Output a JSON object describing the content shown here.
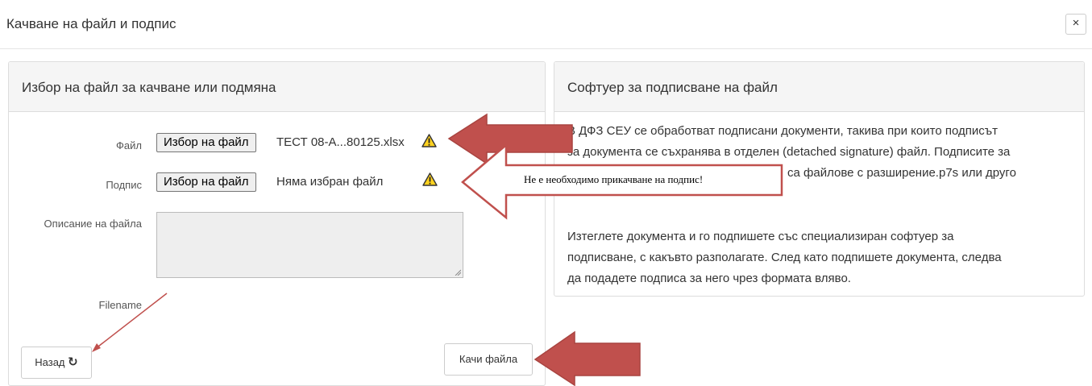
{
  "modal": {
    "title": "Качване на файл и подпис",
    "close_label": "×"
  },
  "left_panel": {
    "title": "Избор на файл за качване или подмяна",
    "file_label": "Файл",
    "file_button": "Избор на файл",
    "file_name": "ТЕСТ 08-А...80125.xlsx",
    "signature_label": "Подпис",
    "signature_button": "Избор на файл",
    "signature_name": "Няма избран файл",
    "description_label": "Описание на файла",
    "filename_label": "Filename",
    "back_button": "Назад",
    "back_icon": "↻",
    "upload_button": "Качи файла"
  },
  "right_panel": {
    "title": "Софтуер за подписване на файл",
    "para1_line1": "В ДФЗ СЕУ се обработват подписани документи, такива при които подписът",
    "para1_line2": "за документа се съхранява в отделен (detached signature) файл. Подписите за",
    "para1_line3": "са файлове с разширение.p7s или друго",
    "para2_line1": "Изтеглете документа и го подпишете със специализиран софтуер за",
    "para2_line2": "подписване, с какъвто разполагате. След като подпишете документа, следва",
    "para2_line3": "да подадете подписа за него чрез формата вляво."
  },
  "annotation": {
    "callout_text": "Не е необходимо прикачване на подпис!"
  },
  "icons": {
    "warning": "warning-icon",
    "close": "close-icon",
    "refresh": "refresh-icon"
  },
  "colors": {
    "arrow_fill": "#c0504d",
    "arrow_stroke": "#b55a55",
    "warning_yellow": "#ffd21f"
  }
}
